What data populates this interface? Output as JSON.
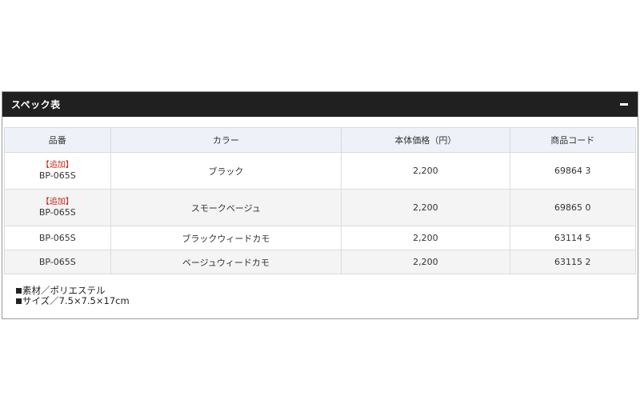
{
  "spec_section": {
    "title": "スペック表",
    "collapse_symbol": "−"
  },
  "table": {
    "headers": [
      "品番",
      "カラー",
      "本体価格（円）",
      "商品コード"
    ],
    "rows": [
      {
        "tag": "【追加】",
        "part_no": "BP-065S",
        "color": "ブラック",
        "price": "2,200",
        "code": "69864 3"
      },
      {
        "tag": "【追加】",
        "part_no": "BP-065S",
        "color": "スモークベージュ",
        "price": "2,200",
        "code": "69865 0"
      },
      {
        "tag": "",
        "part_no": "BP-065S",
        "color": "ブラックウィードカモ",
        "price": "2,200",
        "code": "63114 5"
      },
      {
        "tag": "",
        "part_no": "BP-065S",
        "color": "ベージュウィードカモ",
        "price": "2,200",
        "code": "63115 2"
      }
    ]
  },
  "notes": [
    "素材／ポリエステル",
    "サイズ／7.5×7.5×17cm"
  ],
  "colors": {
    "header_bg": "#202020",
    "table_header_bg": "#eef2f8",
    "tag_red": "#c6251b"
  }
}
